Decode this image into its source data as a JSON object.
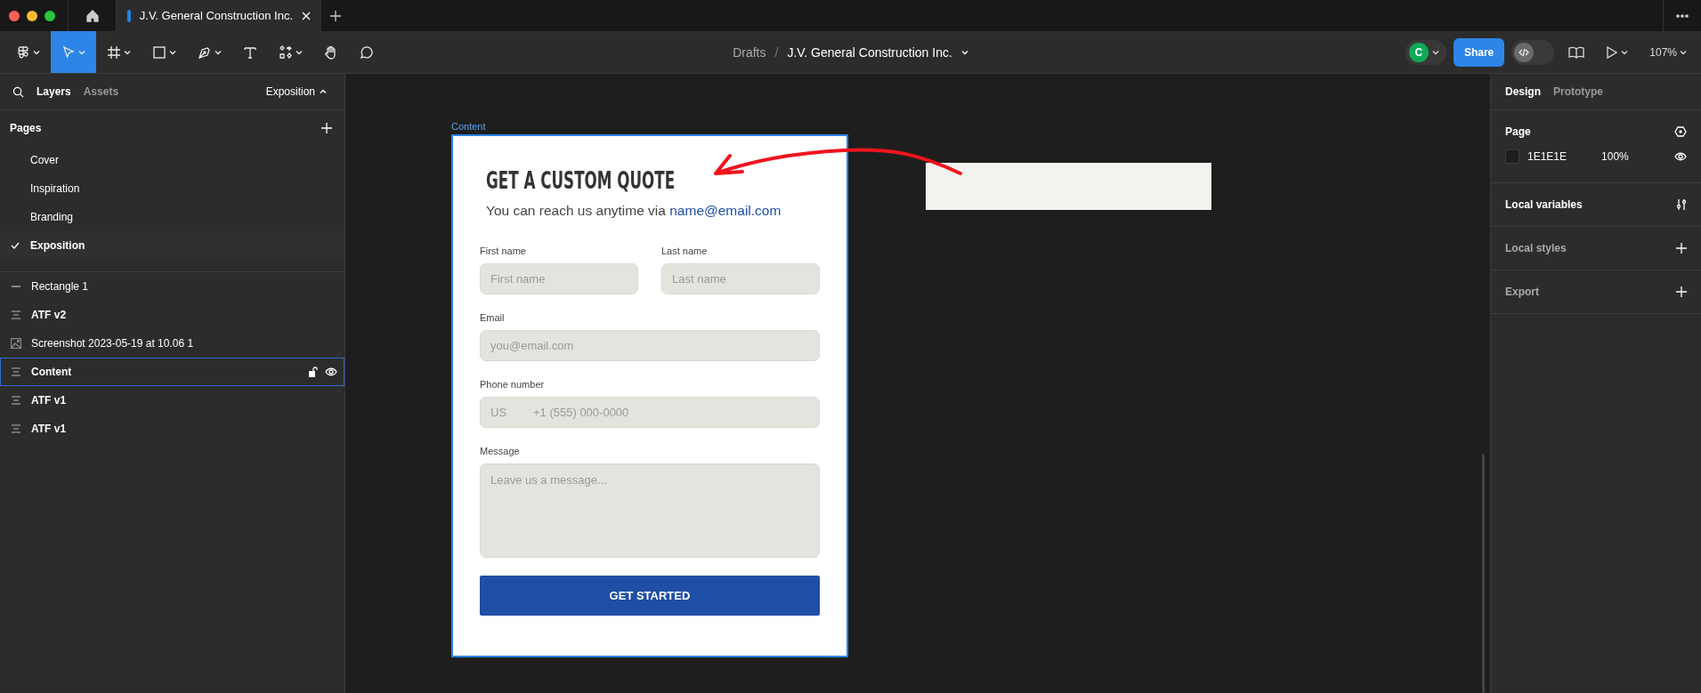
{
  "tab_bar": {
    "tabs": [
      {
        "title": "J.V. General Construction Inc.",
        "selected": true
      }
    ]
  },
  "toolbar": {
    "tools": [
      {
        "kind": "main-menu",
        "selected": false
      },
      {
        "kind": "move",
        "selected": true
      },
      {
        "kind": "frame",
        "selected": false
      },
      {
        "kind": "rectangle",
        "selected": false
      },
      {
        "kind": "pen",
        "selected": false
      },
      {
        "kind": "text",
        "selected": false
      },
      {
        "kind": "resources",
        "selected": false
      },
      {
        "kind": "hand",
        "selected": false
      },
      {
        "kind": "comment",
        "selected": false
      }
    ],
    "breadcrumb": {
      "parent": "Drafts",
      "separator": "/",
      "file": "J.V. General Construction Inc."
    },
    "avatar": {
      "initial": "C"
    },
    "dev_mode": {
      "on": false
    },
    "share_button": "Share",
    "zoom": "107%"
  },
  "left_panel": {
    "tabs": [
      {
        "label": "Layers",
        "selected": true
      },
      {
        "label": "Assets",
        "selected": false
      }
    ],
    "page_menu": "Exposition",
    "pages_heading": "Pages",
    "pages": [
      {
        "name": "Cover",
        "selected": false
      },
      {
        "name": "Inspiration",
        "selected": false
      },
      {
        "name": "Branding",
        "selected": false
      },
      {
        "name": "Exposition",
        "selected": true
      }
    ],
    "layers": [
      {
        "name": "Rectangle 1",
        "kind": "rectangle",
        "selected": false
      },
      {
        "name": "ATF v2",
        "kind": "frame",
        "selected": false
      },
      {
        "name": "Screenshot 2023-05-19 at 10.06 1",
        "kind": "image",
        "selected": false
      },
      {
        "name": "Content",
        "kind": "frame",
        "selected": true
      },
      {
        "name": "ATF v1",
        "kind": "frame",
        "selected": false
      },
      {
        "name": "ATF v1",
        "kind": "frame",
        "selected": false
      }
    ]
  },
  "canvas": {
    "frame_label": "Content",
    "form": {
      "heading": "GET A CUSTOM QUOTE",
      "intro": "You can reach us anytime via",
      "intro_link": "name@email.com",
      "fields": [
        {
          "kind": "half",
          "label": "First name",
          "placeholder": "First name"
        },
        {
          "kind": "half",
          "label": "Last name",
          "placeholder": "Last name"
        },
        {
          "kind": "text",
          "label": "Email",
          "placeholder": "you@email.com"
        },
        {
          "kind": "phone",
          "label": "Phone number",
          "country": "US",
          "placeholder": "+1 (555) 000-0000"
        },
        {
          "kind": "textarea",
          "label": "Message",
          "placeholder": "Leave us a message..."
        }
      ],
      "submit_button": "GET STARTED"
    }
  },
  "right_panel": {
    "tabs": [
      {
        "label": "Design",
        "selected": true
      },
      {
        "label": "Prototype",
        "selected": false
      }
    ],
    "page": {
      "heading": "Page",
      "color": "1E1E1E",
      "opacity": "100%"
    },
    "sections": [
      {
        "label": "Local variables",
        "kind": "variables",
        "dimmed": false
      },
      {
        "label": "Local styles",
        "kind": "add",
        "dimmed": true
      },
      {
        "label": "Export",
        "kind": "add",
        "dimmed": true
      }
    ]
  }
}
